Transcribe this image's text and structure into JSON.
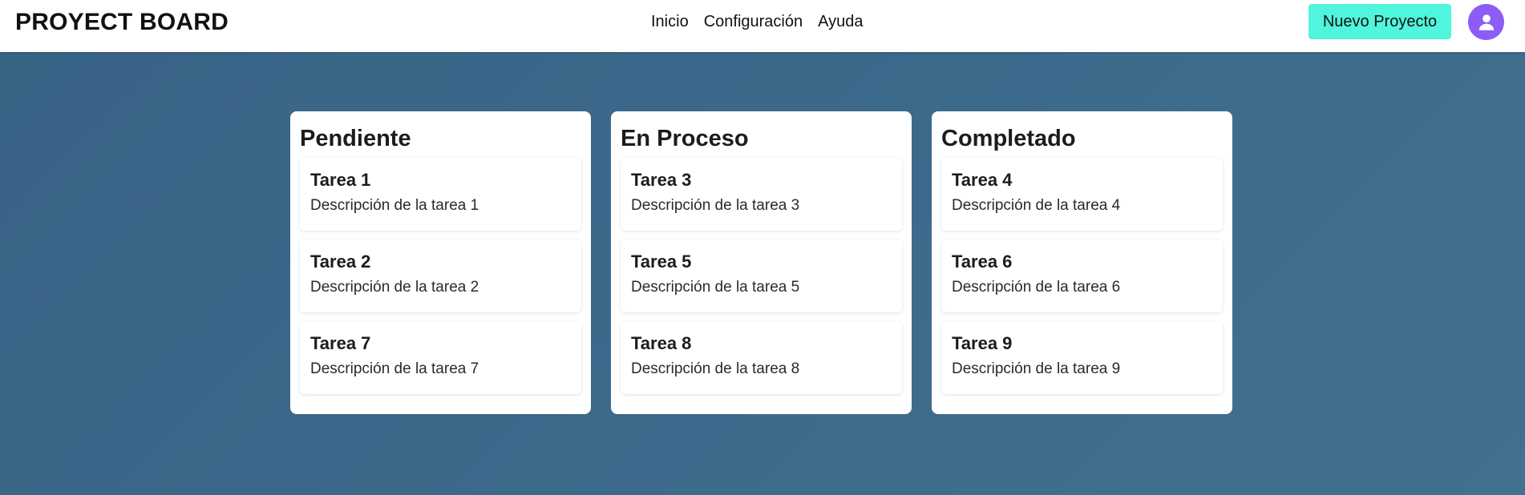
{
  "header": {
    "brand": "PROYECT BOARD",
    "nav": [
      "Inicio",
      "Configuración",
      "Ayuda"
    ],
    "new_project_label": "Nuevo Proyecto",
    "avatar_icon": "user-icon"
  },
  "colors": {
    "background": "#3b678a",
    "accent_button": "#4ff5dc",
    "avatar": "#8b5cf6"
  },
  "columns": [
    {
      "title": "Pendiente",
      "cards": [
        {
          "title": "Tarea 1",
          "description": "Descripción de la tarea 1"
        },
        {
          "title": "Tarea 2",
          "description": "Descripción de la tarea 2"
        },
        {
          "title": "Tarea 7",
          "description": "Descripción de la tarea 7"
        }
      ]
    },
    {
      "title": "En Proceso",
      "cards": [
        {
          "title": "Tarea 3",
          "description": "Descripción de la tarea 3"
        },
        {
          "title": "Tarea 5",
          "description": "Descripción de la tarea 5"
        },
        {
          "title": "Tarea 8",
          "description": "Descripción de la tarea 8"
        }
      ]
    },
    {
      "title": "Completado",
      "cards": [
        {
          "title": "Tarea 4",
          "description": "Descripción de la tarea 4"
        },
        {
          "title": "Tarea 6",
          "description": "Descripción de la tarea 6"
        },
        {
          "title": "Tarea 9",
          "description": "Descripción de la tarea 9"
        }
      ]
    }
  ]
}
